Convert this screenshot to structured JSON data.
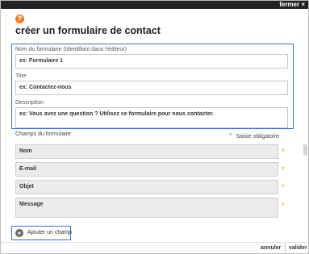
{
  "dialog": {
    "close_label": "fermer ×",
    "help_icon": "?",
    "title": "créer un formulaire de contact"
  },
  "form": {
    "name_label": "Nom du formulaire (Identifiant dans l'éditeur)",
    "name_placeholder": "ex: Formulaire 1",
    "title_label": "Titre",
    "title_placeholder": "ex: Contactez-nous",
    "description_label": "Description",
    "description_placeholder": "ex: Vous avez une question ? Utilisez ce formulaire pour nous contacter."
  },
  "fields_section": {
    "label": "Champs du formulaire",
    "required_star": "*",
    "required_note": "Saisie obligatoire",
    "fields": [
      {
        "label": "Nom",
        "required": true
      },
      {
        "label": "E-mail",
        "required": true
      },
      {
        "label": "Objet",
        "required": true
      },
      {
        "label": "Message",
        "required": true
      }
    ],
    "add_label": "Ajouter un champ",
    "add_icon": "+"
  },
  "footer": {
    "cancel_label": "annuler",
    "confirm_label": "valider"
  },
  "colors": {
    "accent": "#f47b20",
    "focus_border": "#3d6fbd",
    "topbar": "#222222"
  }
}
